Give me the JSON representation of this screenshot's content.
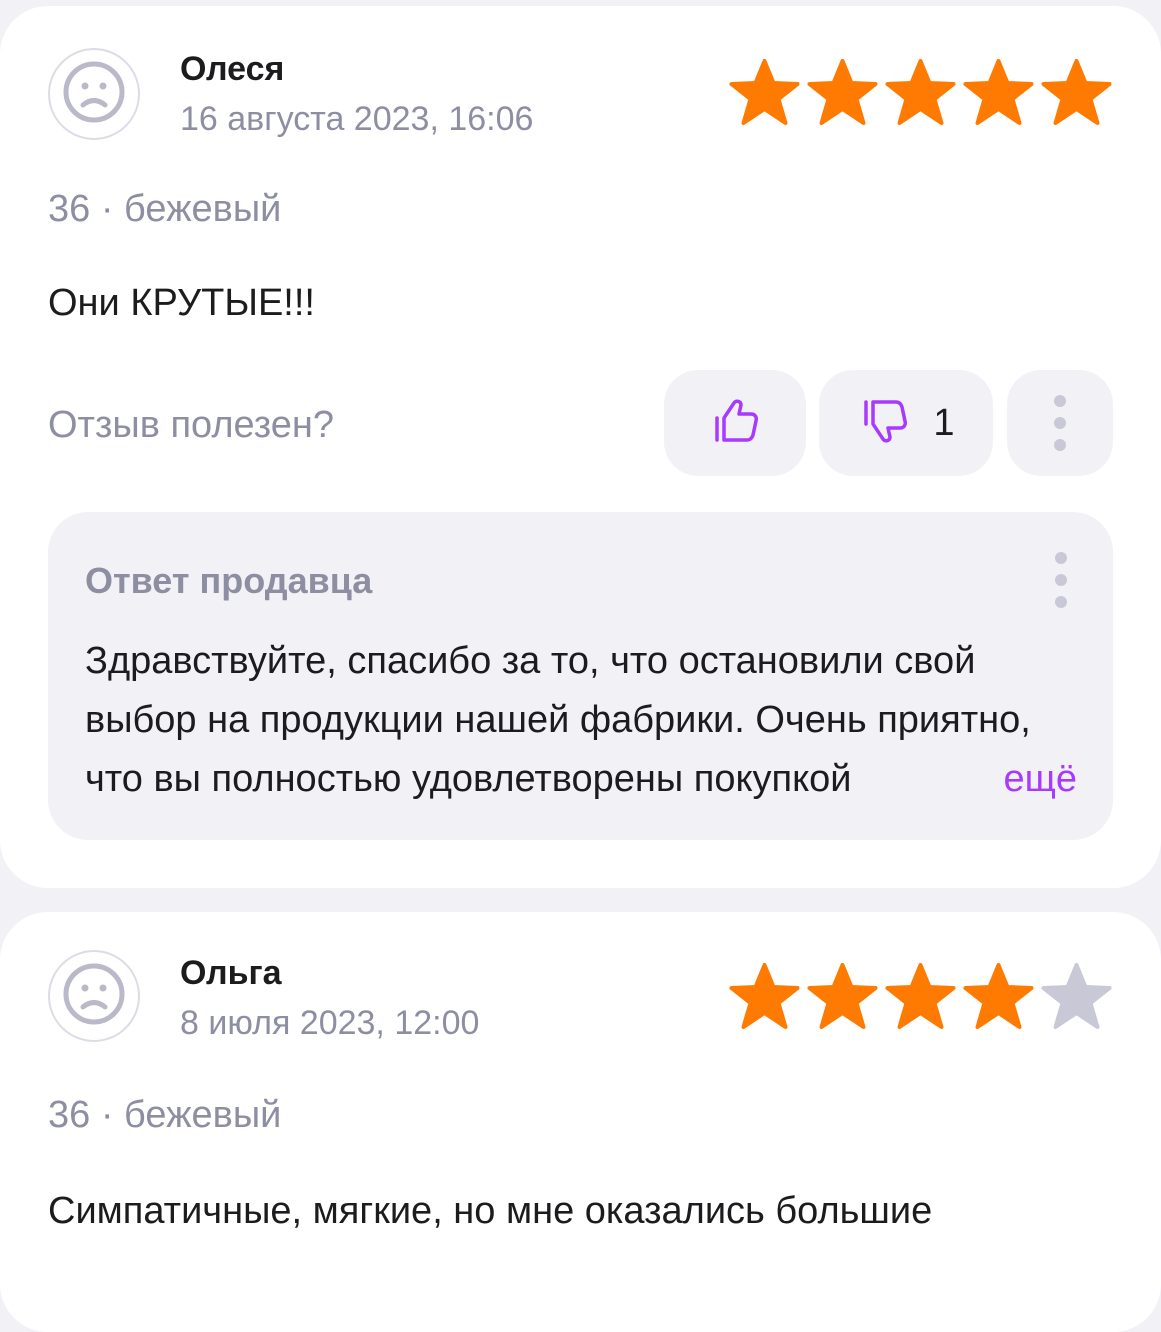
{
  "reviews": [
    {
      "author": "Олеся",
      "date": "16 августа 2023, 16:06",
      "rating": 5,
      "variant": "36 · бежевый",
      "text": "Они КРУТЫЕ!!!",
      "helpful_label": "Отзыв полезен?",
      "dislike_count": "1",
      "seller_reply": {
        "title": "Ответ продавца",
        "text": "Здравствуйте, спасибо за то, что остановили свой выбор на продукции нашей фабрики. Очень приятно, что вы полностью удовлетворены покупкой",
        "more_label": "ещё"
      }
    },
    {
      "author": "Ольга",
      "date": "8 июля 2023, 12:00",
      "rating": 4,
      "variant": "36 · бежевый",
      "text": "Симпатичные, мягкие, но мне оказались большие"
    }
  ],
  "colors": {
    "star_filled": "#ff7a00",
    "star_empty": "#c8c8d6",
    "accent": "#a73afd",
    "muted_text": "#8e8ea3"
  },
  "icons": {
    "avatar": "sad-face-icon",
    "like": "thumbs-up-icon",
    "dislike": "thumbs-down-icon",
    "menu": "more-vertical-icon"
  }
}
